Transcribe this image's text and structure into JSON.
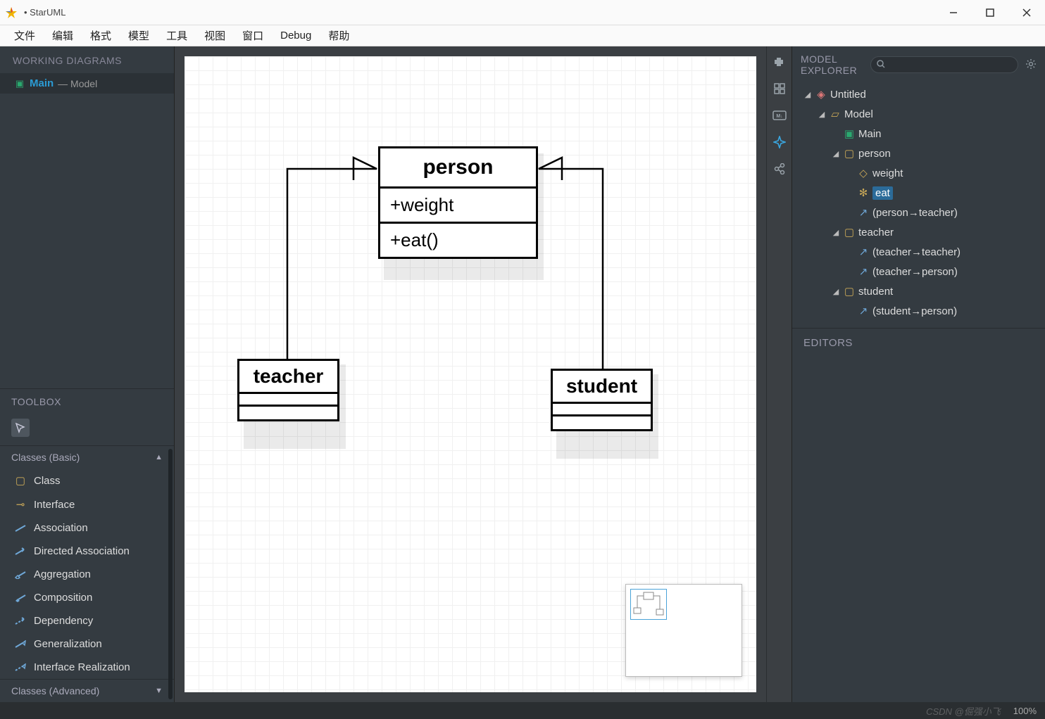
{
  "window": {
    "title": "• StarUML"
  },
  "menu": [
    "文件",
    "编辑",
    "格式",
    "模型",
    "工具",
    "视图",
    "窗口",
    "Debug",
    "帮助"
  ],
  "workingDiagrams": {
    "title": "WORKING DIAGRAMS",
    "item": {
      "name": "Main",
      "parent": "— Model"
    }
  },
  "toolbox": {
    "title": "TOOLBOX",
    "sectionBasic": "Classes (Basic)",
    "sectionAdvanced": "Classes (Advanced)",
    "items": [
      "Class",
      "Interface",
      "Association",
      "Directed Association",
      "Aggregation",
      "Composition",
      "Dependency",
      "Generalization",
      "Interface Realization"
    ]
  },
  "modelExplorer": {
    "title": "MODEL EXPLORER",
    "searchPlaceholder": "",
    "tree": {
      "root": "Untitled",
      "model": "Model",
      "main": "Main",
      "person": "person",
      "weight": "weight",
      "eat": "eat",
      "person_gen": "(person→teacher)",
      "teacher": "teacher",
      "teacher_gen1": "(teacher→teacher)",
      "teacher_gen2": "(teacher→person)",
      "student": "student",
      "student_gen": "(student→person)"
    }
  },
  "editors": {
    "title": "EDITORS"
  },
  "status": {
    "zoom": "100%"
  },
  "diagram": {
    "person": {
      "name": "person",
      "attr": "+weight",
      "op": "+eat()"
    },
    "teacher": {
      "name": "teacher"
    },
    "student": {
      "name": "student"
    }
  },
  "watermark": "CSDN @倔强小飞"
}
